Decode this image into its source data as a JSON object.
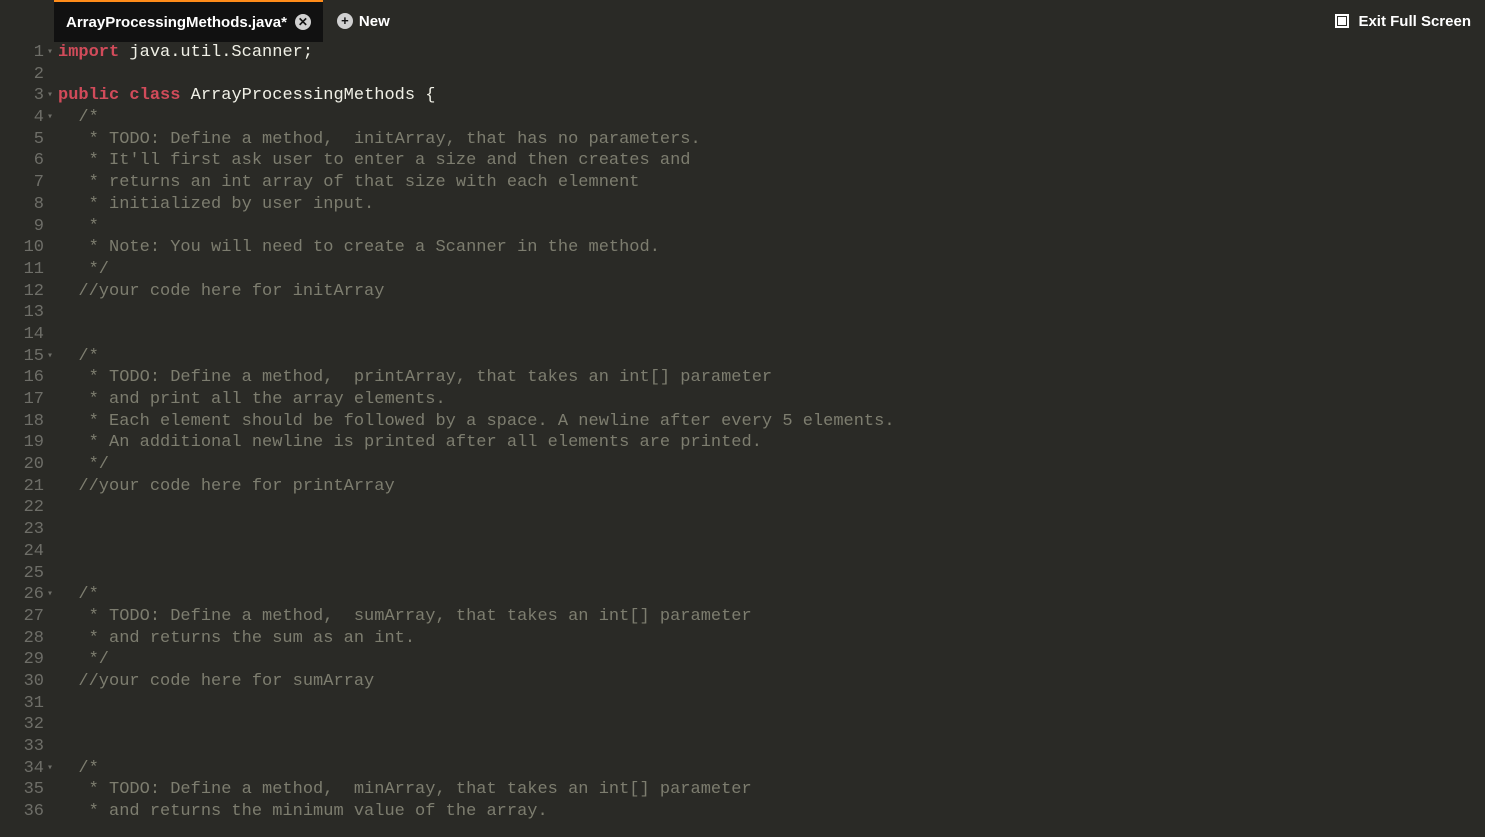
{
  "tab": {
    "title": "ArrayProcessingMethods.java*",
    "close_label": "✕"
  },
  "new_tab": {
    "label": "New",
    "plus": "+"
  },
  "exit_full": {
    "label": "Exit Full Screen"
  },
  "gutter": {
    "numbers": [
      "1",
      "2",
      "3",
      "4",
      "5",
      "6",
      "7",
      "8",
      "9",
      "10",
      "11",
      "12",
      "13",
      "14",
      "15",
      "16",
      "17",
      "18",
      "19",
      "20",
      "21",
      "22",
      "23",
      "24",
      "25",
      "26",
      "27",
      "28",
      "29",
      "30",
      "31",
      "32",
      "33",
      "34",
      "35",
      "36"
    ],
    "fold_lines": [
      1,
      3,
      4,
      15,
      26,
      34
    ]
  },
  "code": {
    "l1": {
      "kw": "import",
      "rest": " java.util.Scanner;"
    },
    "l2": "",
    "l3": {
      "kw1": "public",
      "kw2": "class",
      "name": " ArrayProcessingMethods ",
      "brace": "{"
    },
    "l4": "  /*",
    "l5": "   * TODO: Define a method,  initArray, that has no parameters.",
    "l6": "   * It'll first ask user to enter a size and then creates and",
    "l7": "   * returns an int array of that size with each elemnent",
    "l8": "   * initialized by user input.",
    "l9": "   *",
    "l10": "   * Note: You will need to create a Scanner in the method.",
    "l11": "   */",
    "l12": "  //your code here for initArray",
    "l13": "",
    "l14": "",
    "l15": "  /*",
    "l16": "   * TODO: Define a method,  printArray, that takes an int[] parameter",
    "l17": "   * and print all the array elements.",
    "l18": "   * Each element should be followed by a space. A newline after every 5 elements.",
    "l19": "   * An additional newline is printed after all elements are printed.",
    "l20": "   */",
    "l21": "  //your code here for printArray",
    "l22": "",
    "l23": "",
    "l24": "",
    "l25": "",
    "l26": "  /*",
    "l27": "   * TODO: Define a method,  sumArray, that takes an int[] parameter",
    "l28": "   * and returns the sum as an int.",
    "l29": "   */",
    "l30": "  //your code here for sumArray",
    "l31": "",
    "l32": "",
    "l33": "",
    "l34": "  /*",
    "l35": "   * TODO: Define a method,  minArray, that takes an int[] parameter",
    "l36": "   * and returns the minimum value of the array."
  }
}
